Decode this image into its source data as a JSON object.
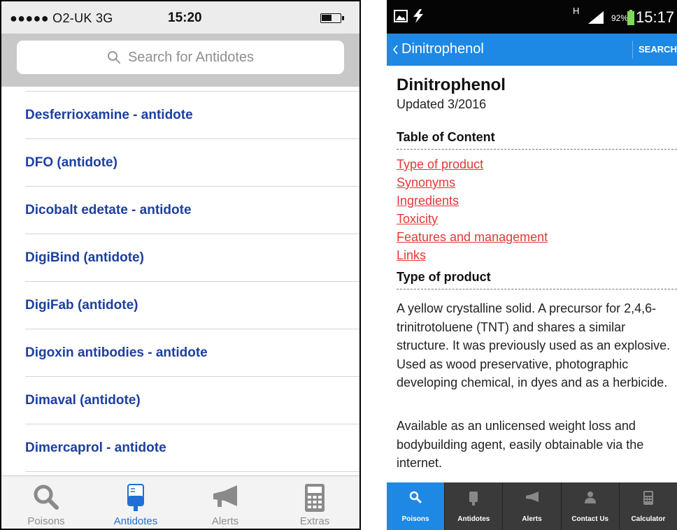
{
  "left_app": {
    "status_bar": {
      "carrier": "●●●●● O2-UK  3G",
      "time": "15:20"
    },
    "search": {
      "placeholder": "Search for Antidotes"
    },
    "list_items": [
      "Desferrioxamine - antidote",
      "DFO (antidote)",
      "Dicobalt edetate - antidote",
      "DigiBind (antidote)",
      "DigiFab (antidote)",
      "Digoxin antibodies - antidote",
      "Dimaval (antidote)",
      "Dimercaprol - antidote"
    ],
    "tabs": [
      {
        "label": "Poisons",
        "icon": "magnifier-icon",
        "active": false
      },
      {
        "label": "Antidotes",
        "icon": "iv-bag-icon",
        "active": true
      },
      {
        "label": "Alerts",
        "icon": "megaphone-icon",
        "active": false
      },
      {
        "label": "Extras",
        "icon": "calculator-icon",
        "active": false
      }
    ],
    "colors": {
      "link": "#1c3fa0",
      "active_tab": "#1f6fd6",
      "inactive_tab": "#8e8e93"
    }
  },
  "right_app": {
    "status_bar": {
      "network": "H",
      "battery": "92%",
      "time": "15:17"
    },
    "app_bar": {
      "back_label": "Dinitrophenol",
      "search_label": "SEARCH"
    },
    "page": {
      "title": "Dinitrophenol",
      "updated": "Updated 3/2016",
      "toc_heading": "Table of Content",
      "toc_links": [
        "Type of product",
        "Synonyms",
        "Ingredients",
        "Toxicity",
        "Features and management",
        "Links"
      ],
      "section_heading": "Type of product",
      "paragraph_1": "A yellow crystalline solid. A precursor for 2,4,6-trinitrotoluene (TNT) and shares a similar structure. It was previously used as an explosive. Used as wood preservative, photographic developing chemical, in dyes and as a herbicide.",
      "paragraph_2": "Available as an unlicensed weight loss and bodybuilding agent, easily obtainable via the internet."
    },
    "nav": [
      {
        "label": "Poisons",
        "icon": "magnifier-icon",
        "active": true
      },
      {
        "label": "Antidotes",
        "icon": "iv-bag-icon",
        "active": false
      },
      {
        "label": "Alerts",
        "icon": "megaphone-icon",
        "active": false
      },
      {
        "label": "Contact Us",
        "icon": "person-icon",
        "active": false
      },
      {
        "label": "Calculator",
        "icon": "calculator-icon",
        "active": false
      }
    ],
    "colors": {
      "app_bar": "#1e88e5",
      "toc_link": "#e53935",
      "nav_bg": "#3a3a3a"
    }
  }
}
